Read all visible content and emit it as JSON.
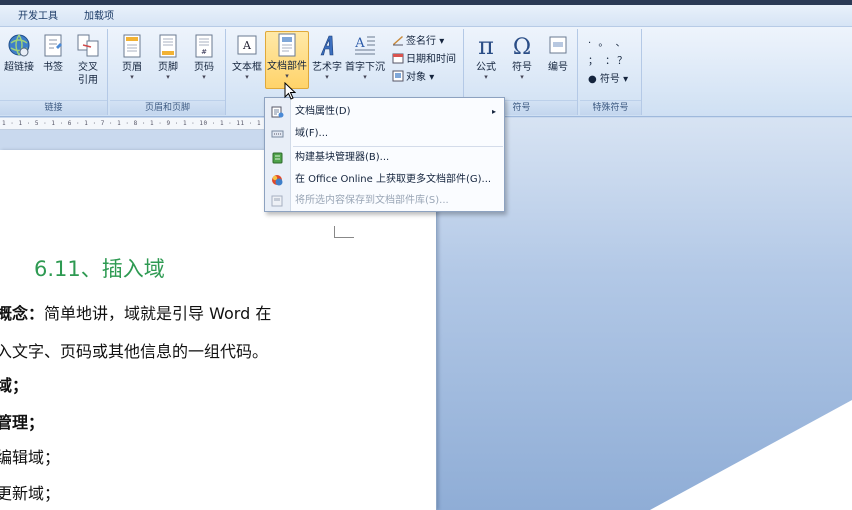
{
  "tabs": {
    "developer": "开发工具",
    "addins": "加载项"
  },
  "ribbon": {
    "links": {
      "label": "链接",
      "hyperlink": "超链接",
      "bookmark": "书签",
      "cross_ref_line1": "交叉",
      "cross_ref_line2": "引用"
    },
    "header_footer": {
      "label": "页眉和页脚",
      "header": "页眉",
      "footer": "页脚",
      "page_number": "页码"
    },
    "text": {
      "textbox": "文本框",
      "quick_parts": "文档部件",
      "wordart": "艺术字",
      "drop_cap": "首字下沉",
      "signature_line": "签名行",
      "date_time": "日期和时间",
      "object": "对象"
    },
    "symbols": {
      "label": "符号",
      "equation": "公式",
      "symbol": "符号",
      "number": "编号"
    },
    "special": {
      "label": "特殊符号",
      "row1": "· 。 、",
      "row2": "； ：？",
      "symbol_btn": "符号"
    },
    "arrow": "▾"
  },
  "dropdown": {
    "items": [
      {
        "label": "文档属性(D)",
        "submenu": "▸"
      },
      {
        "label": "域(F)..."
      },
      {
        "label": "构建基块管理器(B)..."
      },
      {
        "label": "在 Office Online 上获取更多文档部件(G)..."
      },
      {
        "label": "将所选内容保存到文档部件库(S)..."
      }
    ]
  },
  "ruler": {
    "marks": "1 · 1 · 5 · 1 · 6 · 1 · 7 · 1 · 8 · 1 · 9 · 1 · 10 · 1 · 11 · 1 · 12 ·"
  },
  "document": {
    "heading": "6.11、插入域",
    "l1_bold": "概念：",
    "l1_rest": "简单地讲，域就是引导 Word 在",
    "l2": "入文字、页码或其他信息的一组代码。",
    "l3": "域；",
    "l4": "管理；",
    "l5": "编辑域；",
    "l6": "更新域；"
  },
  "colors": {
    "heading_green": "#2e9a52",
    "ribbon_blue": "#dde9f7",
    "active_orange": "#ffd36a",
    "workspace_blue": "#8fadd6"
  }
}
